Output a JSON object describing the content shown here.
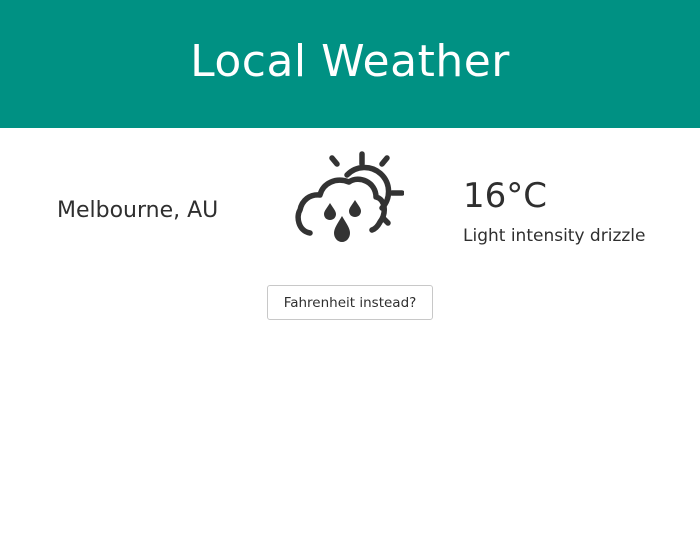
{
  "header": {
    "title": "Local Weather",
    "color": "#009183"
  },
  "location": {
    "city": "Melbourne, AU"
  },
  "weather": {
    "icon": "cloud-sun-drizzle-icon",
    "temperature": "16°C",
    "description": "Light intensity drizzle"
  },
  "toggle": {
    "label": "Fahrenheit instead?"
  }
}
